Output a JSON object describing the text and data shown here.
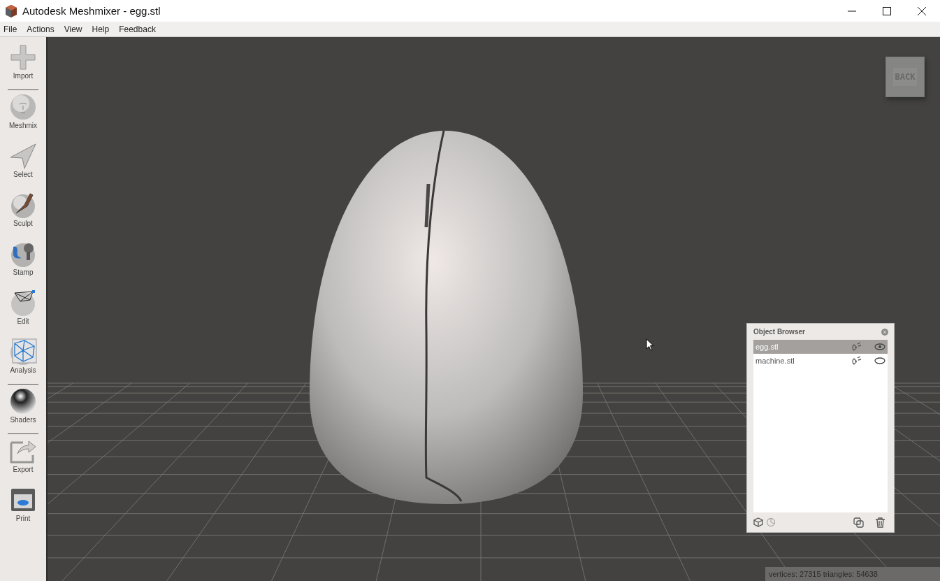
{
  "window": {
    "title": "Autodesk Meshmixer - egg.stl"
  },
  "menu": [
    "File",
    "Actions",
    "View",
    "Help",
    "Feedback"
  ],
  "tools": [
    {
      "kind": "tool",
      "label": "Import"
    },
    {
      "kind": "separator"
    },
    {
      "kind": "tool",
      "label": "Meshmix"
    },
    {
      "kind": "tool",
      "label": "Select"
    },
    {
      "kind": "tool",
      "label": "Sculpt"
    },
    {
      "kind": "tool",
      "label": "Stamp"
    },
    {
      "kind": "tool",
      "label": "Edit"
    },
    {
      "kind": "tool",
      "label": "Analysis"
    },
    {
      "kind": "separator"
    },
    {
      "kind": "tool",
      "label": "Shaders"
    },
    {
      "kind": "separator"
    },
    {
      "kind": "tool",
      "label": "Export"
    },
    {
      "kind": "tool",
      "label": "Print"
    }
  ],
  "view_cube": {
    "face": "BACK"
  },
  "object_browser": {
    "title": "Object Browser",
    "items": [
      {
        "name": "egg.stl",
        "selected": true,
        "visible": true
      },
      {
        "name": "machine.stl",
        "selected": false,
        "visible": false
      }
    ]
  },
  "status_bar": "vertices: 27315 triangles: 54638"
}
